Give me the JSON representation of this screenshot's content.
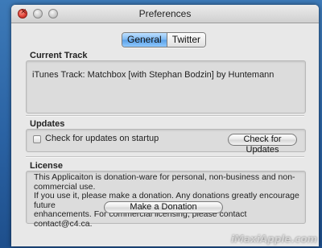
{
  "window": {
    "title": "Preferences"
  },
  "tabs": [
    {
      "label": "General",
      "selected": true
    },
    {
      "label": "Twitter",
      "selected": false
    }
  ],
  "current_track": {
    "header": "Current Track",
    "value": "iTunes Track: Matchbox [with Stephan Bodzin] by Huntemann"
  },
  "updates": {
    "header": "Updates",
    "checkbox_label": "Check for updates on startup",
    "checkbox_checked": false,
    "button_label": "Check for Updates"
  },
  "license": {
    "header": "License",
    "lines": [
      "This Applicaiton is donation-ware for personal, non-business and non-commercial use.",
      "If you use it, please make a donation. Any donations greatly encourage future",
      "enhancements. For commercial licensing, please contact contact@c4.ca."
    ],
    "button_label": "Make a Donation"
  },
  "watermark": "iMaxiApple.com",
  "colors": {
    "selected_tab": "#7cb8f2",
    "window_bg": "#e8e8e8",
    "desktop": "#2a62a3"
  }
}
